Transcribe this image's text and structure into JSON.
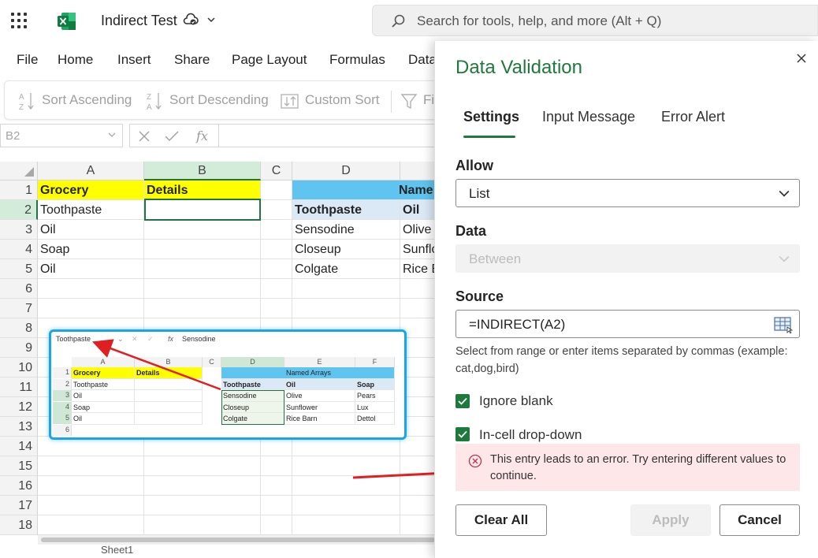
{
  "app": {
    "doc_title": "Indirect Test",
    "search_placeholder": "Search for tools, help, and more (Alt + Q)"
  },
  "tabs": [
    "File",
    "Home",
    "Insert",
    "Share",
    "Page Layout",
    "Formulas",
    "Data"
  ],
  "ribbon": {
    "sort_asc": "Sort Ascending",
    "sort_desc": "Sort Descending",
    "custom_sort": "Custom Sort",
    "filter": "Fi"
  },
  "formula_bar": {
    "name_box": "B2",
    "fx": "fx"
  },
  "grid": {
    "columns": [
      "A",
      "B",
      "C",
      "D"
    ],
    "rows": [
      "1",
      "2",
      "3",
      "4",
      "5",
      "6",
      "7",
      "8",
      "9",
      "10",
      "11",
      "12",
      "13",
      "14",
      "15",
      "16",
      "17",
      "18"
    ],
    "cells": {
      "A1": "Grocery",
      "B1": "Details",
      "D1": "Name",
      "A2": "Toothpaste",
      "D2": "Toothpaste",
      "E2": "Oil",
      "A3": "Oil",
      "D3": "Sensodine",
      "E3": "Olive",
      "A4": "Soap",
      "D4": "Closeup",
      "E4": "Sunflo",
      "A5": "Oil",
      "D5": "Colgate",
      "E5": "Rice B"
    },
    "sheet_tab": "Sheet1"
  },
  "inset": {
    "name_box": "Toothpaste",
    "formula": "Sensodine",
    "fx": "fx",
    "cols": [
      "A",
      "B",
      "C",
      "D",
      "E",
      "F"
    ],
    "rows": [
      "1",
      "2",
      "3",
      "4",
      "5",
      "6"
    ],
    "named_arrays": "Named Arrays",
    "grocery": "Grocery",
    "details": "Details",
    "a": [
      "Toothpaste",
      "Oil",
      "Soap",
      "Oil"
    ],
    "d": [
      "Toothpaste",
      "Sensodine",
      "Closeup",
      "Colgate"
    ],
    "e": [
      "Oil",
      "Olive",
      "Sunflower",
      "Rice Barn"
    ],
    "f": [
      "Soap",
      "Pears",
      "Lux",
      "Dettol"
    ]
  },
  "dialog": {
    "title": "Data Validation",
    "tabs": [
      "Settings",
      "Input Message",
      "Error Alert"
    ],
    "allow_label": "Allow",
    "allow_value": "List",
    "data_label": "Data",
    "data_value": "Between",
    "source_label": "Source",
    "source_value": "=INDIRECT(A2)",
    "hint": "Select from range or enter items separated by commas (example: cat,dog,bird)",
    "ignore_blank": "Ignore blank",
    "in_cell_dropdown": "In-cell drop-down",
    "error_text": "This entry leads to an error. Try entering different values to continue.",
    "clear_all": "Clear All",
    "apply": "Apply",
    "cancel": "Cancel"
  },
  "colors": {
    "excel_green": "#1e7a3c",
    "error_bg": "#fde7e9",
    "highlight_yellow": "#ffff00",
    "header_blue": "#5fc4ef",
    "inset_border": "#1aa6e4",
    "arrow_red": "#e02020"
  }
}
